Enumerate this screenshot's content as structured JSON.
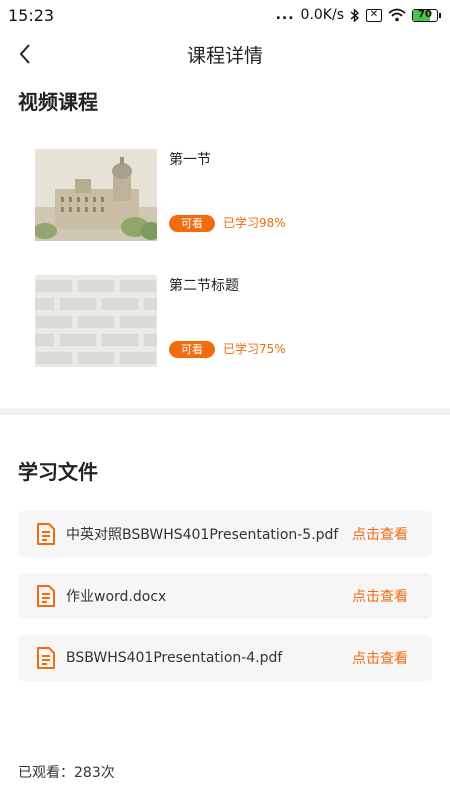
{
  "status_bar": {
    "time": "15:23",
    "dots": "...",
    "network_speed": "0.0K/s",
    "battery_level": "70",
    "icons": [
      "bluetooth-icon",
      "sim-off-icon",
      "wifi-icon",
      "battery-icon"
    ]
  },
  "header": {
    "title": "课程详情",
    "back_icon": "chevron-left-icon"
  },
  "video_section": {
    "title": "视频课程",
    "courses": [
      {
        "title": "第一节",
        "badge": "可看",
        "progress_text": "已学习98%",
        "progress": 0.98,
        "thumb": "city-building-image"
      },
      {
        "title": "第二节标题",
        "badge": "可看",
        "progress_text": "已学习75%",
        "progress": 0.75,
        "thumb": "brick-wall-image"
      }
    ]
  },
  "files_section": {
    "title": "学习文件",
    "files": [
      {
        "name": "中英对照BSBWHS401Presentation-5.pdf",
        "action": "点击查看",
        "icon": "document-icon"
      },
      {
        "name": "作业word.docx",
        "action": "点击查看",
        "icon": "document-icon"
      },
      {
        "name": "BSBWHS401Presentation-4.pdf",
        "action": "点击查看",
        "icon": "document-icon"
      }
    ]
  },
  "footer": {
    "views_label": "已观看：",
    "views_count": "283次"
  },
  "colors": {
    "accent": "#f26b0f",
    "card_bg": "#f6f6f6",
    "divider": "#f2f2f2"
  }
}
